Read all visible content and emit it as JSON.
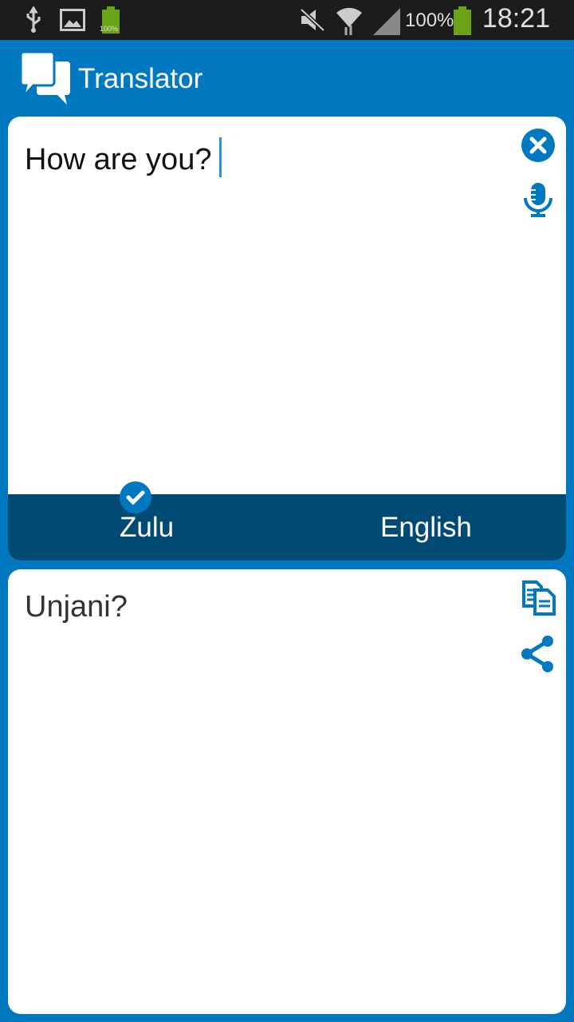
{
  "status_bar": {
    "battery_small_label": "100%",
    "battery_percent": "100%",
    "time": "18:21"
  },
  "app": {
    "title": "Translator",
    "logo_icon": "chat-bubbles-icon"
  },
  "input": {
    "text": "How are you?",
    "clear_icon": "close-circle-icon",
    "mic_icon": "microphone-icon"
  },
  "languages": {
    "source": "Zulu",
    "target": "English",
    "selected": "Zulu"
  },
  "output": {
    "text": "Unjani?",
    "copy_icon": "copy-icon",
    "share_icon": "share-icon"
  },
  "colors": {
    "primary": "#0079c1",
    "dark": "#004a74",
    "status_bar": "#1c1c1c",
    "battery": "#6aa317"
  }
}
